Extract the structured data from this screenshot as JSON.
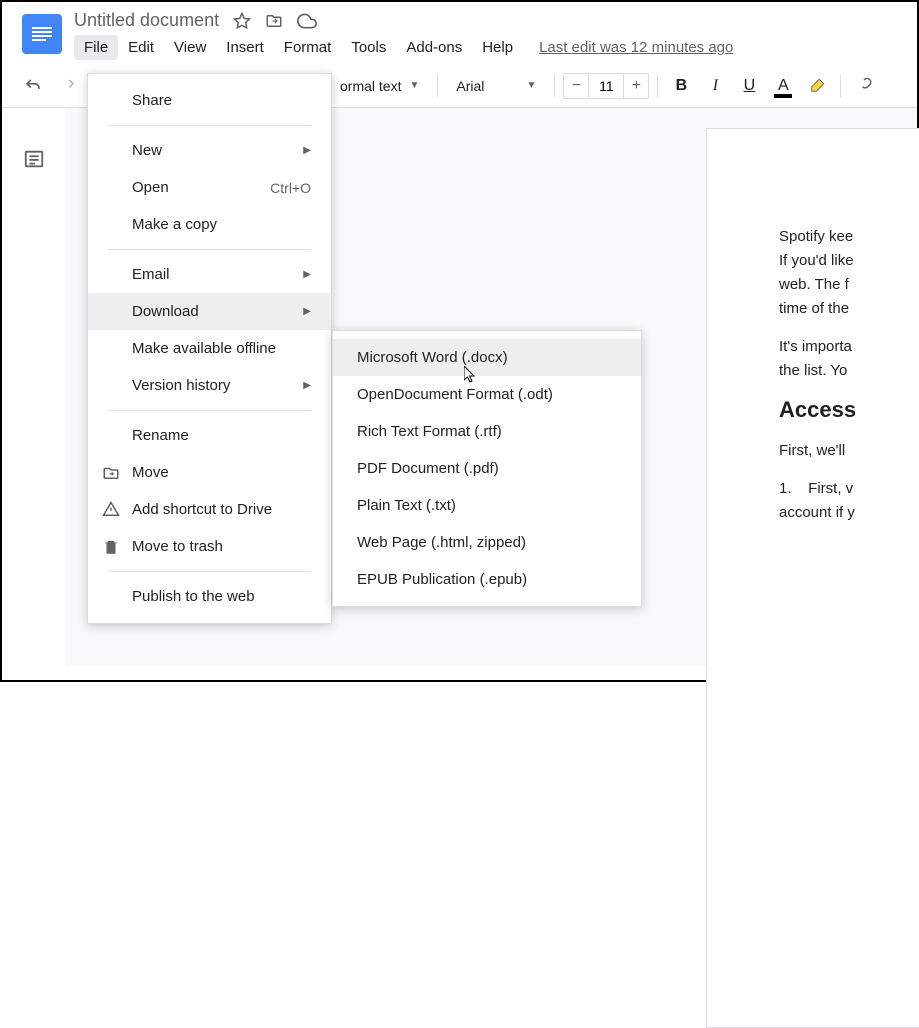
{
  "header": {
    "title": "Untitled document",
    "edit_info": "Last edit was 12 minutes ago"
  },
  "menubar": {
    "file": "File",
    "edit": "Edit",
    "view": "View",
    "insert": "Insert",
    "format": "Format",
    "tools": "Tools",
    "addons": "Add-ons",
    "help": "Help"
  },
  "toolbar": {
    "style_select": "ormal text",
    "font_select": "Arial",
    "font_size": "11"
  },
  "file_menu": {
    "share": "Share",
    "new": "New",
    "open": "Open",
    "open_shortcut": "Ctrl+O",
    "make_copy": "Make a copy",
    "email": "Email",
    "download": "Download",
    "make_offline": "Make available offline",
    "version_history": "Version history",
    "rename": "Rename",
    "move": "Move",
    "add_shortcut": "Add shortcut to Drive",
    "move_trash": "Move to trash",
    "publish_web": "Publish to the web"
  },
  "download_menu": {
    "docx": "Microsoft Word (.docx)",
    "odt": "OpenDocument Format (.odt)",
    "rtf": "Rich Text Format (.rtf)",
    "pdf": "PDF Document (.pdf)",
    "txt": "Plain Text (.txt)",
    "html": "Web Page (.html, zipped)",
    "epub": "EPUB Publication (.epub)"
  },
  "document": {
    "p1": "Spotify kee",
    "p2": "If you'd like",
    "p3": "web. The f",
    "p4": "time of the",
    "p5": "It's importa",
    "p6": "the list. Yo",
    "h1": "Access",
    "p7": "First, we'll",
    "p8": "1.    First, v",
    "p9": "account if y"
  }
}
